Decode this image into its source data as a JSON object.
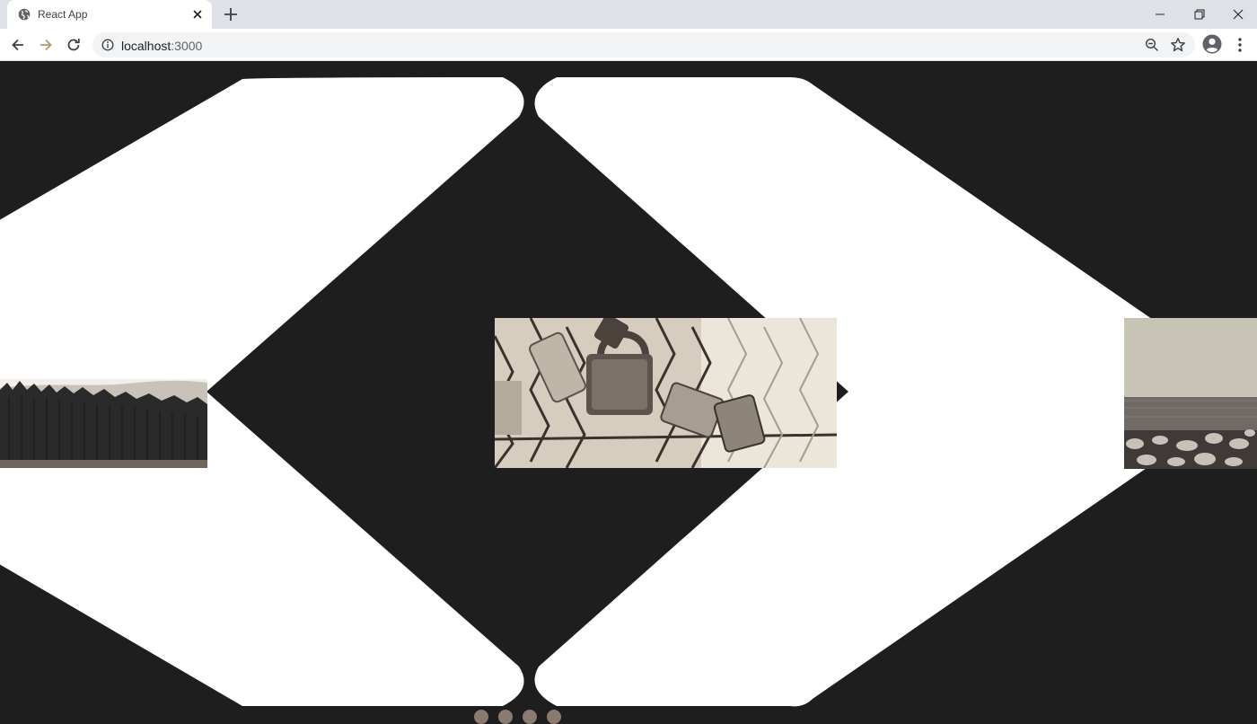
{
  "browser": {
    "tab_title": "React App",
    "url_host": "localhost",
    "url_port": ":3000"
  },
  "icons": {
    "favicon": "globe-icon",
    "tab_close": "close-icon",
    "new_tab": "plus-icon",
    "back": "arrow-left-icon",
    "forward": "arrow-right-icon",
    "reload": "reload-icon",
    "site_info": "info-icon",
    "zoom": "zoom-out-icon",
    "bookmark": "star-icon",
    "profile": "account-icon",
    "menu": "kebab-menu-icon"
  },
  "carousel": {
    "slides": [
      {
        "name": "forest-slide",
        "subject": "pine forest on hillside"
      },
      {
        "name": "padlock-slide",
        "subject": "padlocks on chain-link fence"
      },
      {
        "name": "sea-slide",
        "subject": "rocky shore and sea"
      }
    ],
    "dots": 4,
    "active_dot": 0
  },
  "colors": {
    "page_background": "#1e1e1e",
    "diamond_fill": "#ffffff",
    "dot_color": "#8a7a70",
    "tabstrip": "#dee1e6",
    "omnibox": "#f1f3f4"
  }
}
